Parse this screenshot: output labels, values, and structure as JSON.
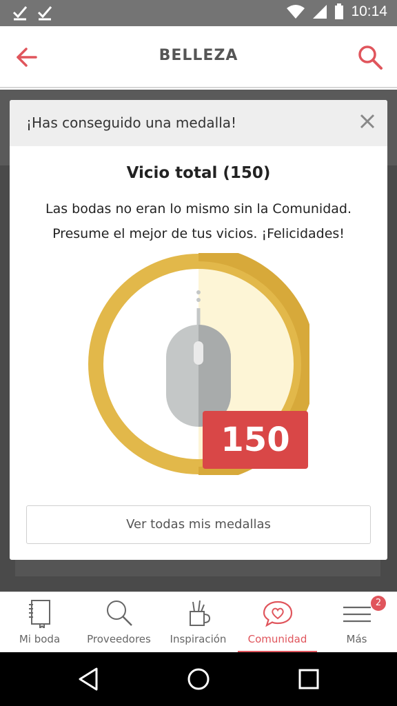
{
  "status_bar": {
    "time": "10:14",
    "icons": [
      "check-icon",
      "check-icon",
      "wifi-icon",
      "signal-icon",
      "battery-icon"
    ]
  },
  "app_bar": {
    "title": "BELLEZA",
    "icons": [
      "back-arrow-icon",
      "search-icon"
    ]
  },
  "modal": {
    "header_title": "¡Has conseguido una medalla!",
    "medal_title": "Vicio total (150)",
    "description_line1": "Las bodas no eran lo mismo sin la Comunidad.",
    "description_line2": "Presume el mejor de tus vicios. ¡Felicidades!",
    "badge_value": "150",
    "cta_label": "Ver todas mis medallas"
  },
  "bottom_nav": {
    "items": [
      {
        "label": "Mi boda",
        "icon": "notebook-icon"
      },
      {
        "label": "Proveedores",
        "icon": "search-icon"
      },
      {
        "label": "Inspiración",
        "icon": "cup-icon"
      },
      {
        "label": "Comunidad",
        "icon": "chat-heart-icon"
      },
      {
        "label": "Más",
        "icon": "menu-icon"
      }
    ],
    "active_index": 3,
    "notification_count": "2"
  },
  "colors": {
    "accent": "#e0555c",
    "medal_gold": "#e2b84a",
    "badge_red": "#d94747"
  }
}
